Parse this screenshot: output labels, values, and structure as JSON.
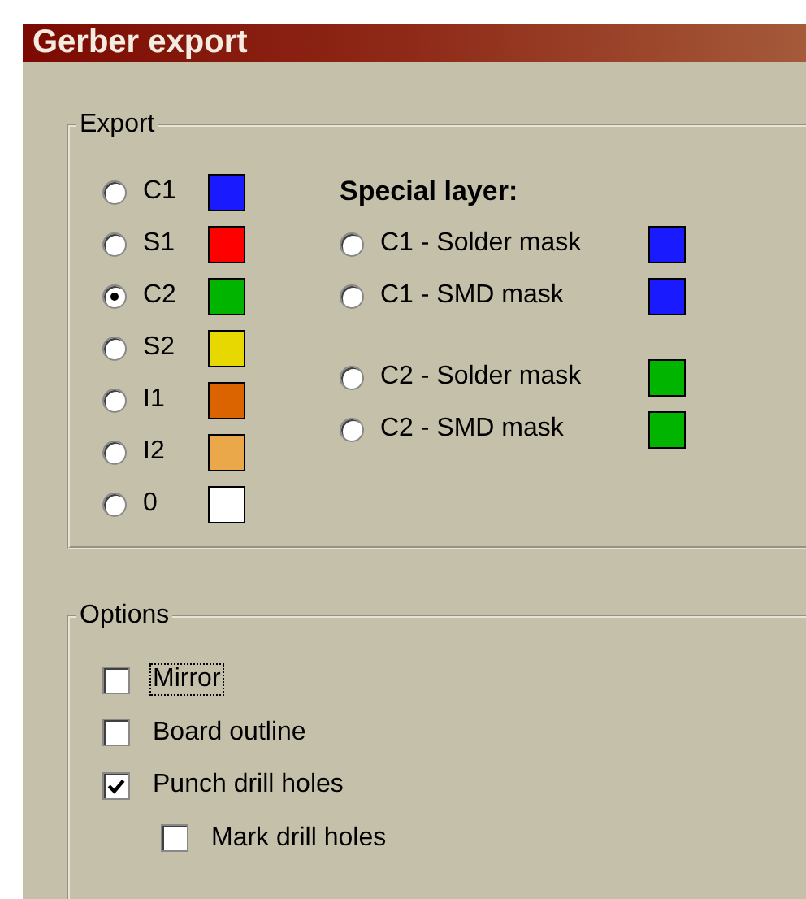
{
  "window": {
    "title": "Gerber export"
  },
  "export": {
    "title": "Export",
    "layers": [
      {
        "label": "C1",
        "selected": false,
        "color": "#1a1aff"
      },
      {
        "label": "S1",
        "selected": false,
        "color": "#ff0000"
      },
      {
        "label": "C2",
        "selected": true,
        "color": "#00b400"
      },
      {
        "label": "S2",
        "selected": false,
        "color": "#e6d800"
      },
      {
        "label": "I1",
        "selected": false,
        "color": "#dc6400"
      },
      {
        "label": "I2",
        "selected": false,
        "color": "#eaa84a"
      },
      {
        "label": "0",
        "selected": false,
        "color": "#ffffff"
      }
    ],
    "special_title": "Special layer:",
    "special_groups": [
      [
        {
          "label": "C1 - Solder mask",
          "selected": false,
          "color": "#1a1aff"
        },
        {
          "label": "C1 - SMD mask",
          "selected": false,
          "color": "#1a1aff"
        }
      ],
      [
        {
          "label": "C2 - Solder mask",
          "selected": false,
          "color": "#00b400"
        },
        {
          "label": "C2 - SMD mask",
          "selected": false,
          "color": "#00b400"
        }
      ]
    ]
  },
  "options": {
    "title": "Options",
    "items": [
      {
        "label": "Mirror",
        "checked": false,
        "focused": true
      },
      {
        "label": "Board outline",
        "checked": false,
        "focused": false
      },
      {
        "label": "Punch drill holes",
        "checked": true,
        "focused": false,
        "children": [
          {
            "label": "Mark drill holes",
            "checked": false,
            "focused": false
          }
        ]
      }
    ]
  }
}
